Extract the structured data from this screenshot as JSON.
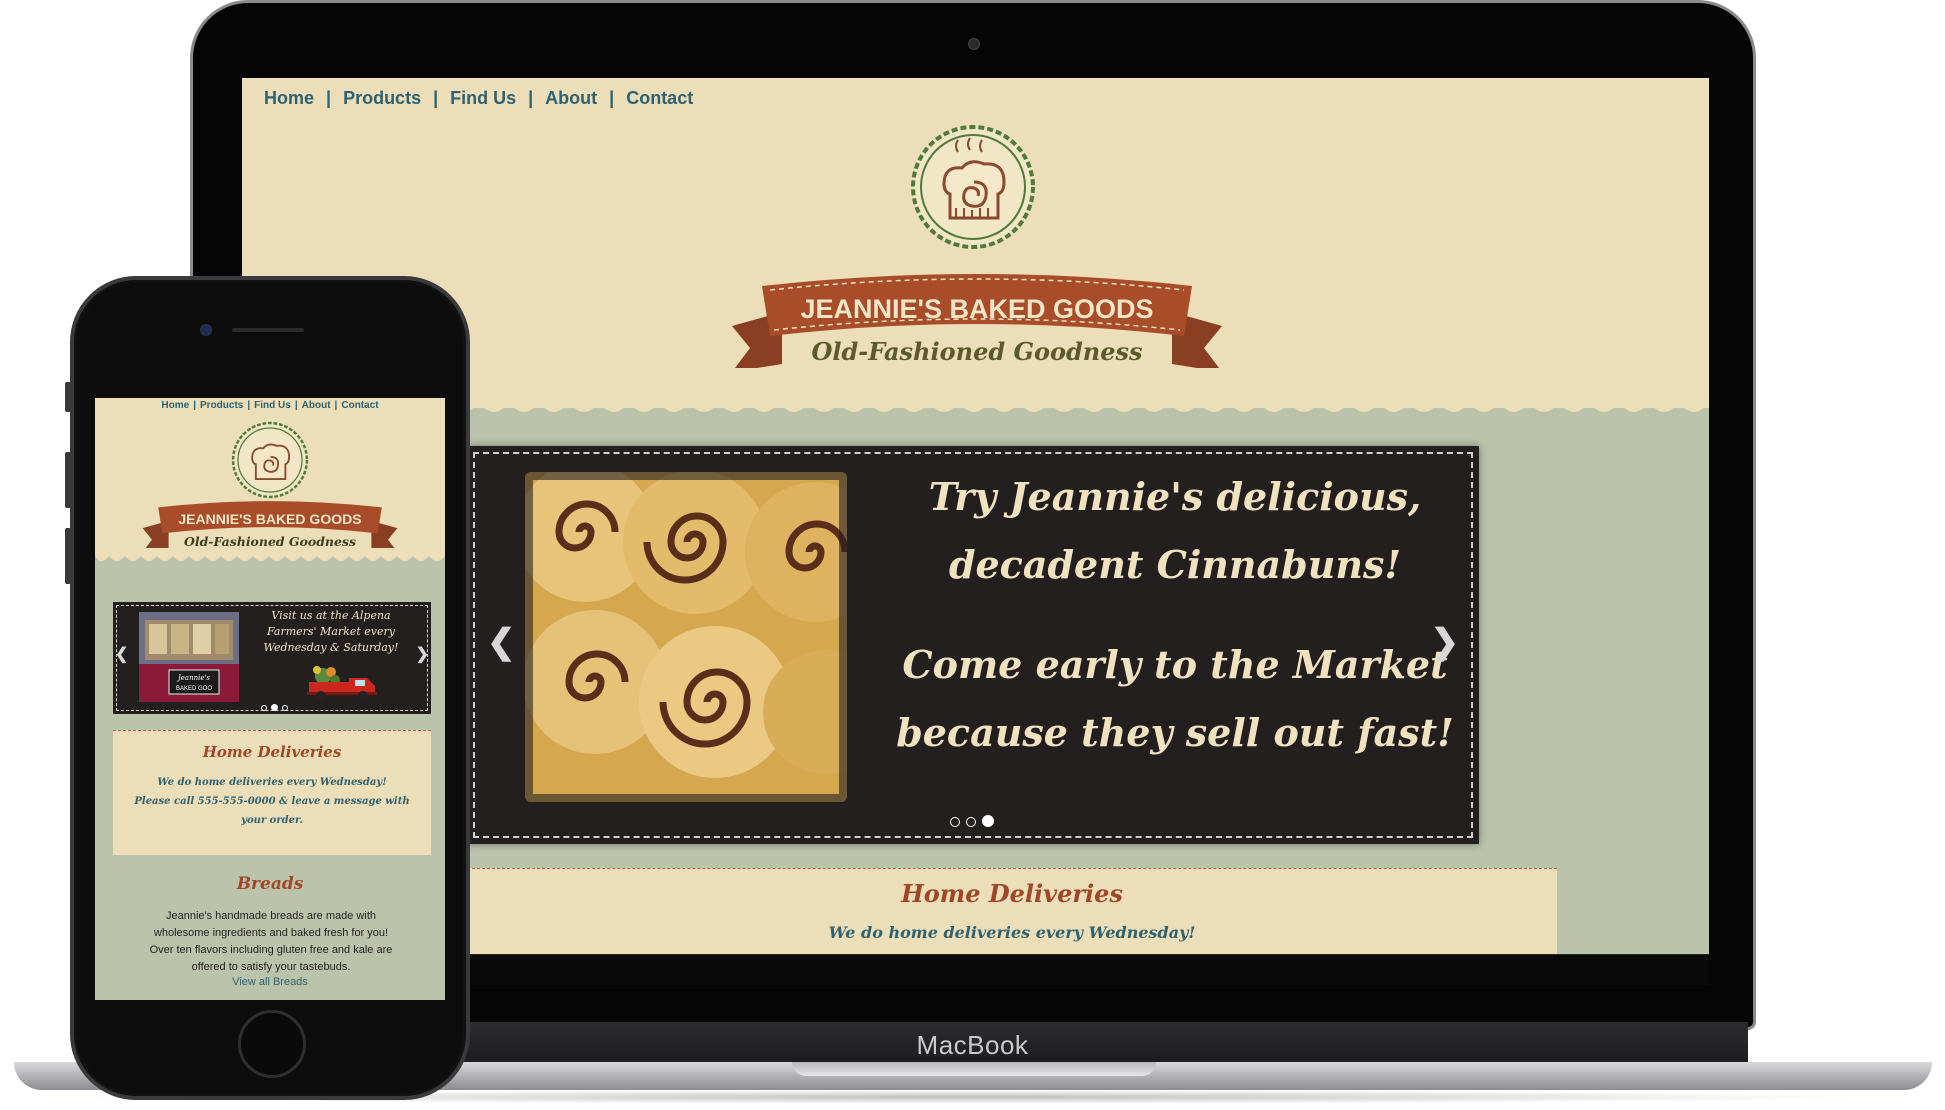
{
  "device_laptop": {
    "label": "MacBook"
  },
  "desktop_site": {
    "nav": [
      "Home",
      "Products",
      "Find Us",
      "About",
      "Contact"
    ],
    "nav_separator": "|",
    "brand_name": "JEANNIE'S BAKED GOODS",
    "tagline": "Old-Fashioned Goodness",
    "slider": {
      "line1": "Try Jeannie's delicious,",
      "line2": "decadent Cinnabuns!",
      "line3": "Come early to the Market",
      "line4": "because they sell out fast!",
      "prev_icon": "chevron-left-icon",
      "next_icon": "chevron-right-icon",
      "dot_count": 3,
      "active_dot": 3
    },
    "deliveries": {
      "title": "Home Deliveries",
      "line": "We do home deliveries every Wednesday!"
    }
  },
  "mobile_site": {
    "nav": [
      "Home",
      "Products",
      "Find Us",
      "About",
      "Contact"
    ],
    "nav_separator": "|",
    "brand_name": "JEANNIE'S BAKED GOODS",
    "tagline": "Old-Fashioned Goodness",
    "slider": {
      "text": "Visit us at the Alpena Farmers' Market every Wednesday & Saturday!",
      "sign_text": "Jeannie's Baked Goo",
      "active_dot": 2,
      "dot_count": 3
    },
    "deliveries": {
      "title": "Home Deliveries",
      "line1": "We do home deliveries every Wednesday!",
      "line2": "Please call 555-555-0000 & leave a message with your order."
    },
    "breads": {
      "title": "Breads",
      "text": "Jeannie's handmade breads are made with wholesome ingredients and baked fresh for you! Over ten flavors including gluten free and kale are offered to satisfy your tastebuds.",
      "link": "View all Breads"
    }
  },
  "colors": {
    "cream": "#ecdeb8",
    "sage": "#bcc3ab",
    "teal_text": "#2f6270",
    "rust": "#a0472a",
    "dark_slider": "#231f1f"
  }
}
